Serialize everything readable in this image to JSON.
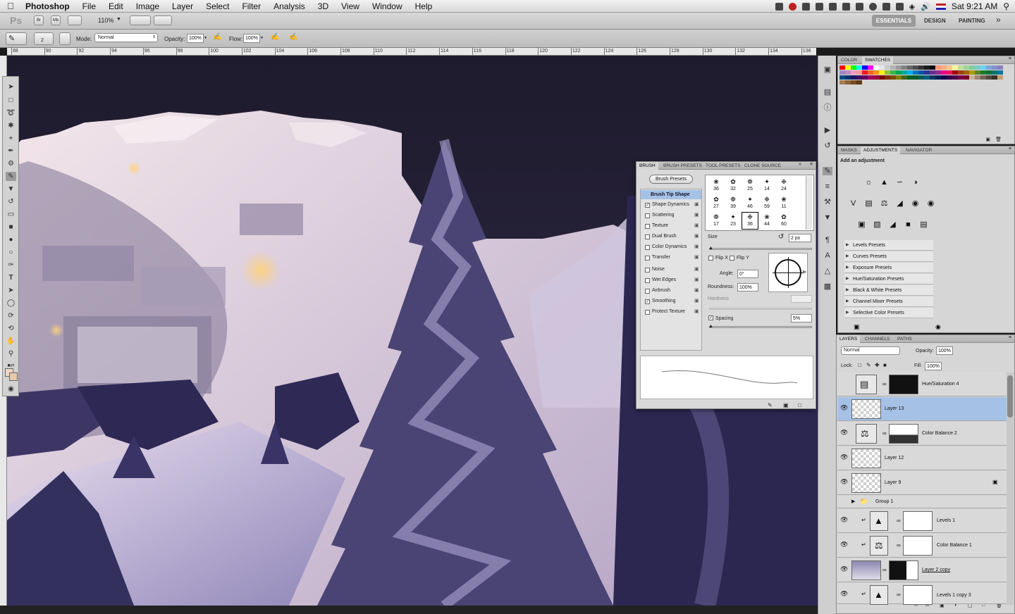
{
  "menubar": {
    "app_name": "Photoshop",
    "items": [
      "File",
      "Edit",
      "Image",
      "Layer",
      "Select",
      "Filter",
      "Analysis",
      "3D",
      "View",
      "Window",
      "Help"
    ],
    "clock": "Sat 9:21 AM"
  },
  "appbar": {
    "logo": "Ps",
    "zoom": "110%",
    "workspaces": [
      "ESSENTIALS",
      "DESIGN",
      "PAINTING"
    ],
    "more": "»"
  },
  "options": {
    "brush_size": "2",
    "mode_label": "Mode:",
    "mode_value": "Normal",
    "opacity_label": "Opacity:",
    "opacity_value": "100%",
    "flow_label": "Flow:",
    "flow_value": "100%"
  },
  "ruler": {
    "ticks": [
      "88",
      "90",
      "92",
      "94",
      "96",
      "98",
      "100",
      "102",
      "104",
      "106",
      "108",
      "110",
      "112",
      "114",
      "116",
      "118",
      "120",
      "122",
      "124",
      "126",
      "128",
      "130",
      "132",
      "134",
      "136"
    ]
  },
  "brush_panel": {
    "tabs": [
      "BRUSH",
      "BRUSH PRESETS",
      "TOOL PRESETS",
      "CLONE SOURCE"
    ],
    "presets_button": "Brush Presets",
    "options": [
      {
        "label": "Brush Tip Shape",
        "checked": null
      },
      {
        "label": "Shape Dynamics",
        "checked": true
      },
      {
        "label": "Scattering",
        "checked": false
      },
      {
        "label": "Texture",
        "checked": false
      },
      {
        "label": "Dual Brush",
        "checked": false
      },
      {
        "label": "Color Dynamics",
        "checked": false
      },
      {
        "label": "Transfer",
        "checked": false
      },
      {
        "label": "Noise",
        "checked": false
      },
      {
        "label": "Wet Edges",
        "checked": false
      },
      {
        "label": "Airbrush",
        "checked": false
      },
      {
        "label": "Smoothing",
        "checked": true
      },
      {
        "label": "Protect Texture",
        "checked": false
      }
    ],
    "tip_sizes_row1": [
      "36",
      "32",
      "25",
      "14",
      "24"
    ],
    "tip_sizes_row2": [
      "27",
      "39",
      "46",
      "59",
      "11"
    ],
    "tip_sizes_row3": [
      "17",
      "23",
      "36",
      "44",
      "60"
    ],
    "size_label": "Size",
    "size_value": "2 px",
    "flip_x": "Flip X",
    "flip_y": "Flip Y",
    "angle_label": "Angle:",
    "angle_value": "0°",
    "roundness_label": "Roundness:",
    "roundness_value": "100%",
    "hardness_label": "Hardness",
    "spacing_label": "Spacing",
    "spacing_value": "5%"
  },
  "color_panel": {
    "tabs": [
      "COLOR",
      "SWATCHES"
    ],
    "swatch_colors": [
      "#ff0000",
      "#ffff00",
      "#00ff00",
      "#00ffff",
      "#0000ff",
      "#ff00ff",
      "#ffffff",
      "#e6e6e6",
      "#cccccc",
      "#b3b3b3",
      "#999999",
      "#808080",
      "#666666",
      "#4d4d4d",
      "#333333",
      "#1a1a1a",
      "#000000",
      "#f7977a",
      "#f9ad81",
      "#fdc68a",
      "#fff79a",
      "#c4df9b",
      "#a2d39c",
      "#82ca9d",
      "#7bcdc8",
      "#6ecff6",
      "#7ea7d8",
      "#8493ca",
      "#8882be",
      "#a187be",
      "#bc8dbf",
      "#f49ac2",
      "#f6989d",
      "#ed1c24",
      "#f26522",
      "#f7941d",
      "#fff200",
      "#8dc63f",
      "#39b54a",
      "#00a651",
      "#00a99d",
      "#00aeef",
      "#0072bc",
      "#0054a6",
      "#2e3192",
      "#662d91",
      "#92278f",
      "#ec008c",
      "#ed145b",
      "#9e0b0f",
      "#a0410d",
      "#a36209",
      "#aba000",
      "#598527",
      "#1a7b30",
      "#007236",
      "#00746b",
      "#0076a3",
      "#004b80",
      "#003471",
      "#1b1464",
      "#440e62",
      "#630460",
      "#9e005d",
      "#9e0039",
      "#790000",
      "#7b2e00",
      "#7d4900",
      "#827b00",
      "#406618",
      "#005e20",
      "#005826",
      "#005952",
      "#005b7f",
      "#003663",
      "#002157",
      "#0d004c",
      "#32004b",
      "#4b0049",
      "#7b0046",
      "#7a0026",
      "#c7b299",
      "#998675",
      "#736357",
      "#534741",
      "#37302d",
      "#c69c6d",
      "#a67c52",
      "#8c6239",
      "#754c24",
      "#603913"
    ]
  },
  "adjustments_panel": {
    "tabs": [
      "MASKS",
      "ADJUSTMENTS",
      "NAVIGATOR"
    ],
    "title": "Add an adjustment",
    "presets": [
      "Levels Presets",
      "Curves Presets",
      "Exposure Presets",
      "Hue/Saturation Presets",
      "Black & White Presets",
      "Channel Mixer Presets",
      "Selective Color Presets"
    ]
  },
  "layers_panel": {
    "tabs": [
      "LAYERS",
      "CHANNELS",
      "PATHS"
    ],
    "blend_mode": "Normal",
    "opacity_label": "Opacity:",
    "opacity_value": "100%",
    "lock_label": "Lock:",
    "fill_label": "Fill:",
    "fill_value": "100%",
    "layers": [
      {
        "name": "Hue/Saturation 4",
        "visible": false
      },
      {
        "name": "Layer 13",
        "visible": true
      },
      {
        "name": "Color Balance 2",
        "visible": true
      },
      {
        "name": "Layer 12",
        "visible": true
      },
      {
        "name": "Layer 9",
        "visible": true
      },
      {
        "name": "Group 1",
        "visible": false
      },
      {
        "name": "Levels 1",
        "visible": true
      },
      {
        "name": "Color Balance 1",
        "visible": true
      },
      {
        "name": "Layer 2 copy",
        "visible": true
      },
      {
        "name": "Levels 1 copy 3",
        "visible": true
      }
    ]
  }
}
